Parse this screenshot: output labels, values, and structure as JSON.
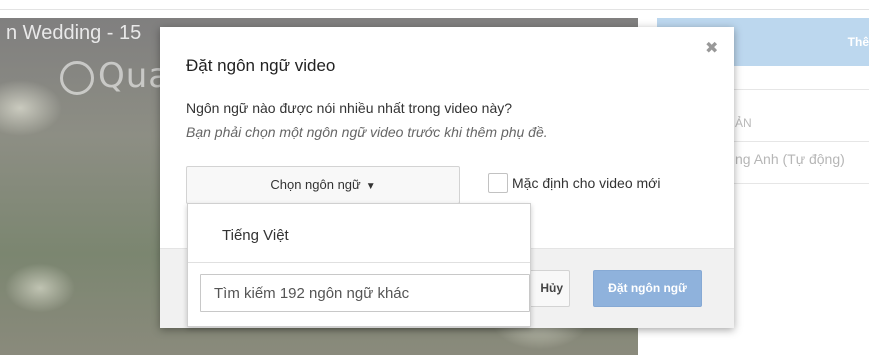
{
  "background": {
    "video_title": "n Wedding - 15",
    "watermark": "Quantrimang",
    "right_panel": {
      "header_text": "Thê",
      "column_label": "ẢN",
      "row_value": "ng Anh (Tự động)"
    }
  },
  "modal": {
    "title": "Đặt ngôn ngữ video",
    "question": "Ngôn ngữ nào được nói nhiều nhất trong video này?",
    "note": "Bạn phải chọn một ngôn ngữ video trước khi thêm phụ đề.",
    "select_button_label": "Chọn ngôn ngữ",
    "caret": "▼",
    "default_checkbox_label": "Mặc định cho video mới",
    "cancel_label": "Hủy",
    "set_language_label": "Đặt ngôn ngữ",
    "close_glyph": "✖"
  },
  "dropdown": {
    "options": [
      "Tiếng Việt"
    ],
    "search_placeholder": "Tìm kiếm 192 ngôn ngữ khác"
  },
  "colors": {
    "primary_button": "#8fb2dc",
    "panel_header": "#bcd7ee"
  }
}
